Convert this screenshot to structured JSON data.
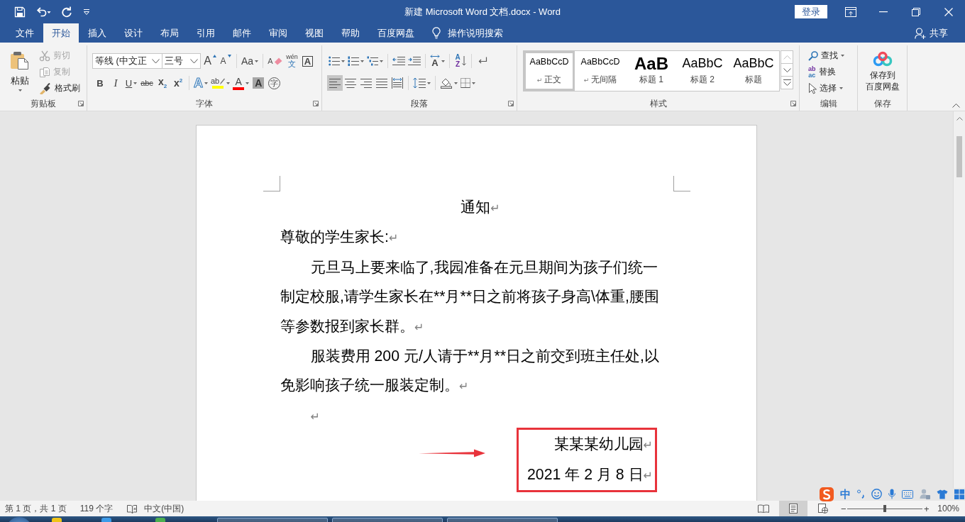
{
  "window": {
    "title": "新建 Microsoft Word 文档.docx - Word",
    "login": "登录"
  },
  "quick_access": [
    {
      "kind": "save"
    },
    {
      "kind": "undo"
    },
    {
      "kind": "redo"
    },
    {
      "kind": "customize"
    }
  ],
  "tabs": [
    {
      "label": "文件",
      "selected": false
    },
    {
      "label": "开始",
      "selected": true
    },
    {
      "label": "插入",
      "selected": false
    },
    {
      "label": "设计",
      "selected": false
    },
    {
      "label": "布局",
      "selected": false
    },
    {
      "label": "引用",
      "selected": false
    },
    {
      "label": "邮件",
      "selected": false
    },
    {
      "label": "审阅",
      "selected": false
    },
    {
      "label": "视图",
      "selected": false
    },
    {
      "label": "帮助",
      "selected": false
    },
    {
      "label": "百度网盘",
      "selected": false
    }
  ],
  "tell_me": {
    "label": "操作说明搜索"
  },
  "share": {
    "label": "共享"
  },
  "ribbon": {
    "clipboard": {
      "label": "剪贴板",
      "launcher": true,
      "paste": "粘贴",
      "items": [
        {
          "kind": "cut",
          "label": "剪切",
          "disabled": true
        },
        {
          "kind": "copy",
          "label": "复制",
          "disabled": true
        },
        {
          "kind": "format_painter",
          "label": "格式刷",
          "disabled": false
        }
      ]
    },
    "font": {
      "label": "字体",
      "launcher": true,
      "font_name": "等线 (中文正",
      "font_size": "三号",
      "row1": [
        {
          "kind": "grow",
          "glyph": "A",
          "dropdown": false
        },
        {
          "kind": "shrink",
          "glyph": "A",
          "dropdown": false
        },
        {
          "kind": "change_case",
          "glyph": "Aa",
          "dropdown": true
        },
        {
          "kind": "clear_formatting",
          "glyph": "A",
          "dropdown": false
        },
        {
          "kind": "phonetic_guide",
          "glyph": "wén",
          "glyph_below": "文",
          "dropdown": false
        },
        {
          "kind": "character_border",
          "glyph": "A",
          "dropdown": false
        }
      ],
      "row2": [
        {
          "kind": "bold",
          "glyph": "B",
          "dropdown": false
        },
        {
          "kind": "italic",
          "glyph": "I",
          "dropdown": false
        },
        {
          "kind": "underline",
          "glyph": "U",
          "dropdown": true
        },
        {
          "kind": "strikethrough",
          "glyph": "abc",
          "dropdown": false
        },
        {
          "kind": "subscript",
          "glyph": "x$_{2}$",
          "dropdown": false
        },
        {
          "kind": "superscript",
          "glyph": "x$^{2}$",
          "dropdown": false
        },
        {
          "kind": "text_effects",
          "glyph": "A",
          "dropdown": true
        },
        {
          "kind": "highlight",
          "glyph": "ab",
          "color": "#ffff00",
          "dropdown": true
        },
        {
          "kind": "font_color",
          "glyph": "A",
          "color": "#ff0000",
          "dropdown": true
        },
        {
          "kind": "character_shading",
          "glyph": "A",
          "dropdown": false
        },
        {
          "kind": "enclose_characters",
          "glyph": "字",
          "dropdown": false
        }
      ]
    },
    "paragraph": {
      "label": "段落",
      "launcher": true,
      "row1": [
        {
          "kind": "bullets",
          "dropdown": true
        },
        {
          "kind": "numbering",
          "dropdown": true
        },
        {
          "kind": "multilevel_list",
          "dropdown": true
        },
        {
          "kind": "decrease_indent",
          "dropdown": false
        },
        {
          "kind": "increase_indent",
          "dropdown": false
        },
        {
          "kind": "asian_layout",
          "glyph": "A",
          "dropdown": true
        },
        {
          "kind": "sort",
          "glyph": "A",
          "glyph_below": "Z",
          "dropdown": false
        },
        {
          "kind": "show_marks",
          "dropdown": false
        }
      ],
      "row2": [
        {
          "kind": "align_left",
          "selected": true,
          "dropdown": false
        },
        {
          "kind": "align_center",
          "selected": false,
          "dropdown": false
        },
        {
          "kind": "align_right",
          "selected": false,
          "dropdown": false
        },
        {
          "kind": "justify",
          "selected": false,
          "dropdown": false
        },
        {
          "kind": "distributed",
          "selected": false,
          "dropdown": false
        },
        {
          "kind": "line_spacing",
          "selected": false,
          "dropdown": true
        },
        {
          "kind": "shading",
          "selected": false,
          "dropdown": true
        },
        {
          "kind": "borders",
          "selected": false,
          "dropdown": true
        }
      ]
    },
    "styles": {
      "label": "样式",
      "launcher": true,
      "items": [
        {
          "kind": "normal",
          "preview": "AaBbCcD",
          "mark": "↵",
          "name": "正文",
          "selected": true
        },
        {
          "kind": "no_spacing",
          "preview": "AaBbCcD",
          "mark": "↵",
          "name": "无间隔",
          "selected": false
        },
        {
          "kind": "heading1",
          "preview": "AaB",
          "name": "标题 1",
          "selected": false
        },
        {
          "kind": "heading2",
          "preview": "AaBbC",
          "name": "标题 2",
          "selected": false
        },
        {
          "kind": "title",
          "preview": "AaBbC",
          "name": "标题",
          "selected": false
        }
      ]
    },
    "editing": {
      "label": "编辑",
      "items": [
        {
          "kind": "find",
          "label": "查找",
          "dropdown": true
        },
        {
          "kind": "replace",
          "label": "替换",
          "glyph": "ab",
          "glyph_below": "ac",
          "dropdown": false
        },
        {
          "kind": "select",
          "label": "选择",
          "dropdown": true
        }
      ]
    },
    "save": {
      "label": "保存",
      "button": [
        "保存到",
        "百度网盘"
      ]
    }
  },
  "document": {
    "blocks": [
      {
        "kind": "title",
        "text": "通知",
        "mark": "↵"
      },
      {
        "kind": "plain",
        "text": "尊敬的学生家长:",
        "mark": "↵"
      },
      {
        "kind": "indented",
        "text": "元旦马上要来临了,我园准备在元旦期间为孩子们统一制定校服,请学生家长在**月**日之前将孩子身高\\体重,腰围等参数报到家长群。",
        "mark": "↵"
      },
      {
        "kind": "indented",
        "text": "服装费用 200 元/人请于**月**日之前交到班主任处,以免影响孩子统一服装定制。",
        "mark": "↵"
      },
      {
        "kind": "indented",
        "mark": "↵"
      }
    ],
    "signature": {
      "framed": true,
      "arrow": true,
      "lines": [
        {
          "text": "某某某幼儿园",
          "mark": "↵"
        },
        {
          "text": "2021 年 2 月 8 日",
          "mark": "↵"
        }
      ]
    }
  },
  "status_bar": {
    "page": "第 1 页，共 1 页",
    "words": "119 个字",
    "language": "中文(中国)",
    "views": [
      {
        "kind": "read",
        "selected": false
      },
      {
        "kind": "print",
        "selected": true
      },
      {
        "kind": "web",
        "selected": false
      }
    ],
    "zoom": {
      "minus": "−",
      "plus": "+",
      "level": 0.5,
      "percent": "100%"
    }
  },
  "ime_toolbar": {
    "mode": "中"
  }
}
